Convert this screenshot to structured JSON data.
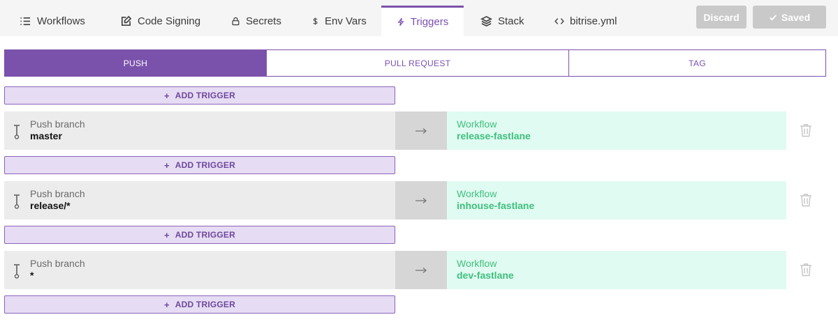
{
  "nav": {
    "tabs": [
      {
        "label": "Workflows",
        "icon": "list-icon"
      },
      {
        "label": "Code Signing",
        "icon": "edit-icon"
      },
      {
        "label": "Secrets",
        "icon": "lock-icon"
      },
      {
        "label": "Env Vars",
        "icon": "dollar-icon"
      },
      {
        "label": "Triggers",
        "icon": "bolt-icon",
        "active": true
      },
      {
        "label": "Stack",
        "icon": "layers-icon"
      },
      {
        "label": "bitrise.yml",
        "icon": "code-icon"
      }
    ],
    "discard_label": "Discard",
    "saved_label": "Saved"
  },
  "trigger_types": [
    {
      "label": "PUSH",
      "active": true
    },
    {
      "label": "PULL REQUEST",
      "active": false
    },
    {
      "label": "TAG",
      "active": false
    }
  ],
  "add_trigger_label": "ADD TRIGGER",
  "triggers": [
    {
      "branch_label": "Push branch",
      "branch": "master",
      "workflow_label": "Workflow",
      "workflow": "release-fastlane"
    },
    {
      "branch_label": "Push branch",
      "branch": "release/*",
      "workflow_label": "Workflow",
      "workflow": "inhouse-fastlane"
    },
    {
      "branch_label": "Push branch",
      "branch": "*",
      "workflow_label": "Workflow",
      "workflow": "dev-fastlane"
    }
  ],
  "colors": {
    "accent": "#7b52ab",
    "add_trigger_bg": "#e6dcf3",
    "workflow_bg": "#e0fbf1",
    "workflow_text": "#3fbf7e",
    "branch_bg": "#ececec",
    "button_disabled": "#c9c9c9"
  }
}
